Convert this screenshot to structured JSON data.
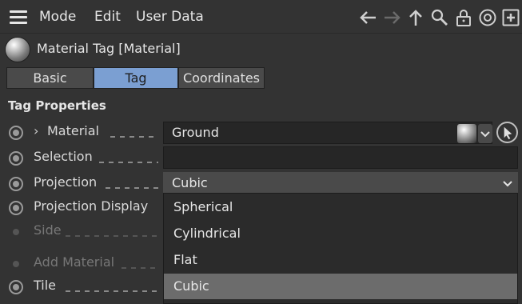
{
  "menubar": {
    "items": [
      "Mode",
      "Edit",
      "User Data"
    ],
    "icons": [
      "back-arrow-icon",
      "forward-arrow-icon",
      "up-arrow-icon",
      "search-icon",
      "lock-icon",
      "target-icon",
      "new-panel-icon"
    ]
  },
  "header": {
    "title": "Material Tag [Material]"
  },
  "tabs": [
    {
      "label": "Basic",
      "active": false
    },
    {
      "label": "Tag",
      "active": true
    },
    {
      "label": "Coordinates",
      "active": false
    }
  ],
  "section": {
    "title": "Tag Properties"
  },
  "properties": {
    "material": {
      "label": "Material",
      "value": "Ground"
    },
    "selection": {
      "label": "Selection",
      "value": ""
    },
    "projection": {
      "label": "Projection",
      "value": "Cubic"
    },
    "projection_display": {
      "label": "Projection Display"
    },
    "side": {
      "label": "Side"
    },
    "add_material": {
      "label": "Add Material"
    },
    "tile": {
      "label": "Tile"
    }
  },
  "dropdown": {
    "options": [
      "Spherical",
      "Cylindrical",
      "Flat",
      "Cubic"
    ],
    "selected": "Cubic"
  },
  "colors": {
    "background": "#333333",
    "active_tab": "#7b9fd2",
    "selected_option": "#6c6c6c"
  }
}
